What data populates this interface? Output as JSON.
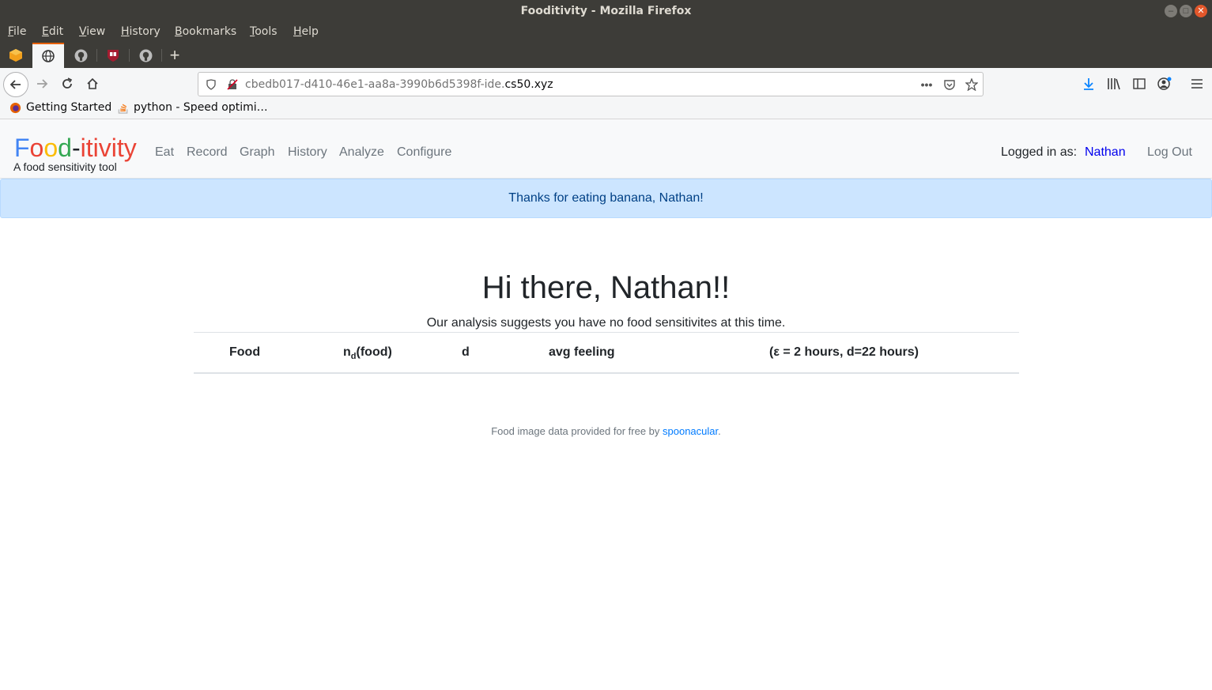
{
  "window": {
    "title": "Fooditivity - Mozilla Firefox"
  },
  "menu": [
    "File",
    "Edit",
    "View",
    "History",
    "Bookmarks",
    "Tools",
    "Help"
  ],
  "toolbar": {
    "url_prefix": "cbedb017-d410-46e1-aa8a-3990b6d5398f-ide.",
    "url_domain": "cs50.xyz"
  },
  "bookmarks": [
    {
      "label": "Getting Started",
      "icon": "firefox-icon"
    },
    {
      "label": "python - Speed optimi…",
      "icon": "stackoverflow-icon"
    }
  ],
  "site": {
    "brand_letters": [
      {
        "ch": "F",
        "color": "#4285f4"
      },
      {
        "ch": "o",
        "color": "#ea4335"
      },
      {
        "ch": "o",
        "color": "#fbbc05"
      },
      {
        "ch": "d",
        "color": "#34a853"
      },
      {
        "ch": "-",
        "color": "#212529"
      },
      {
        "ch": "itivity",
        "color": "#ea4335"
      }
    ],
    "tagline": "A food sensitivity tool",
    "nav": [
      "Eat",
      "Record",
      "Graph",
      "History",
      "Analyze",
      "Configure"
    ],
    "logged_in_label": "Logged in as:",
    "username": "Nathan",
    "logout_label": "Log Out"
  },
  "alert": "Thanks for eating banana, Nathan!",
  "heading": "Hi there, Nathan!!",
  "subtitle": "Our analysis suggests you have no food sensitivites at this time.",
  "table": {
    "col_food": "Food",
    "col_n_base": "n",
    "col_n_sub": "d",
    "col_n_rest": "(food)",
    "col_d": "d",
    "col_avg": "avg feeling",
    "col_params": "(ε = 2 hours, d=22 hours)"
  },
  "footer": {
    "prefix": "Food image data provided for free by ",
    "link": "spoonacular",
    "suffix": "."
  }
}
